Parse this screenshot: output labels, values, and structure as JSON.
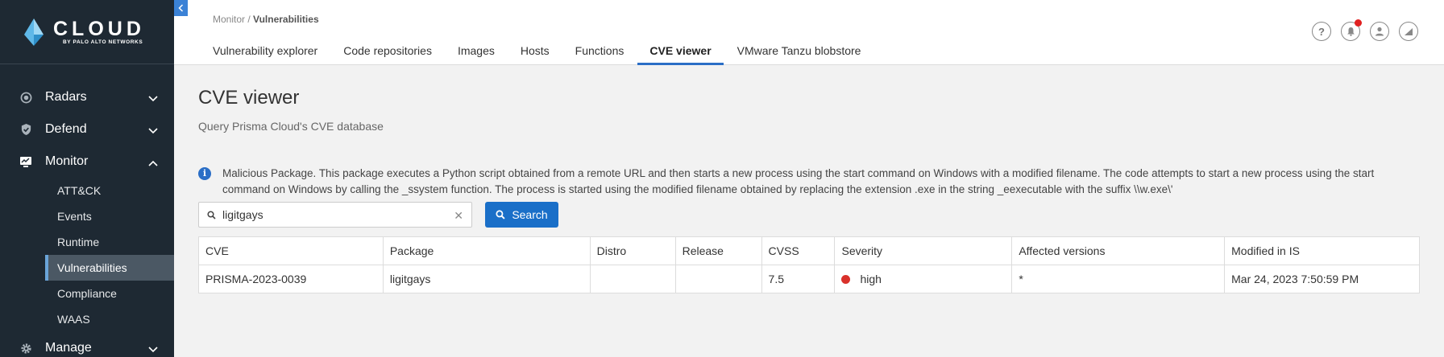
{
  "brand": {
    "name": "CLOUD",
    "sub": "BY PALO ALTO NETWORKS"
  },
  "sidebar": {
    "sections": [
      {
        "label": "Radars",
        "icon": "radar-icon",
        "expanded": false
      },
      {
        "label": "Defend",
        "icon": "shield-icon",
        "expanded": false
      },
      {
        "label": "Monitor",
        "icon": "monitor-icon",
        "expanded": true
      },
      {
        "label": "Manage",
        "icon": "gear-icon",
        "expanded": false
      }
    ],
    "monitor_items": [
      "ATT&CK",
      "Events",
      "Runtime",
      "Vulnerabilities",
      "Compliance",
      "WAAS"
    ],
    "active_item": "Vulnerabilities"
  },
  "header": {
    "breadcrumb_parent": "Monitor",
    "breadcrumb_sep": " / ",
    "breadcrumb_current": "Vulnerabilities",
    "tabs": [
      "Vulnerability explorer",
      "Code repositories",
      "Images",
      "Hosts",
      "Functions",
      "CVE viewer",
      "VMware Tanzu blobstore"
    ],
    "active_tab": "CVE viewer"
  },
  "main": {
    "title": "CVE viewer",
    "subtitle": "Query Prisma Cloud's CVE database",
    "info_text": "Malicious Package. This package executes a Python script obtained from a remote URL and then starts a new process using the start command on Windows with a modified filename. The code attempts to start a new process using the start command on Windows by calling the _ssystem function. The process is started using the modified filename obtained by replacing the extension .exe in the string _eexecutable with the suffix \\\\w.exe\\'",
    "search_value": "ligitgays",
    "search_button": "Search"
  },
  "table": {
    "columns": [
      "CVE",
      "Package",
      "Distro",
      "Release",
      "CVSS",
      "Severity",
      "Affected versions",
      "Modified in IS"
    ],
    "rows": [
      {
        "cve": "PRISMA-2023-0039",
        "package": "ligitgays",
        "distro": "",
        "release": "",
        "cvss": "7.5",
        "severity": "high",
        "affected": "*",
        "modified": "Mar 24, 2023 7:50:59 PM"
      }
    ]
  },
  "colors": {
    "sidebar_bg": "#1e2933",
    "accent": "#1a6fc8",
    "severity_high": "#d9312b",
    "notification": "#e02020"
  }
}
